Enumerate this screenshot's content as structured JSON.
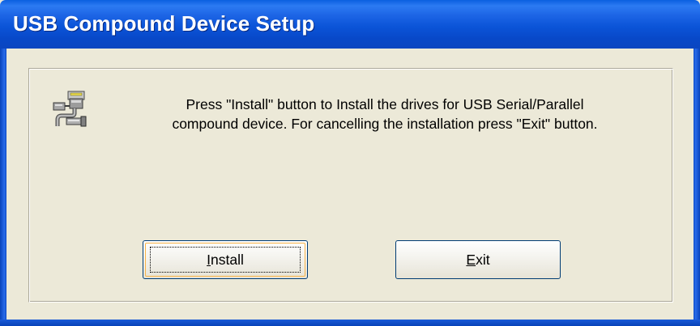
{
  "window": {
    "title": "USB Compound Device Setup"
  },
  "icon": {
    "name": "usb-plug-icon"
  },
  "message": {
    "line1": "Press \"Install\" button to Install the drives for USB Serial/Parallel",
    "line2": "compound device. For cancelling the installation press \"Exit\" button."
  },
  "buttons": {
    "install": {
      "mnemonic": "I",
      "rest": "nstall"
    },
    "exit": {
      "mnemonic": "E",
      "rest": "xit"
    }
  },
  "colors": {
    "titlebar": "#0A5FE0",
    "dialog_bg": "#ECE9D8",
    "button_border": "#003C74",
    "default_button_highlight": "#F8B348"
  }
}
